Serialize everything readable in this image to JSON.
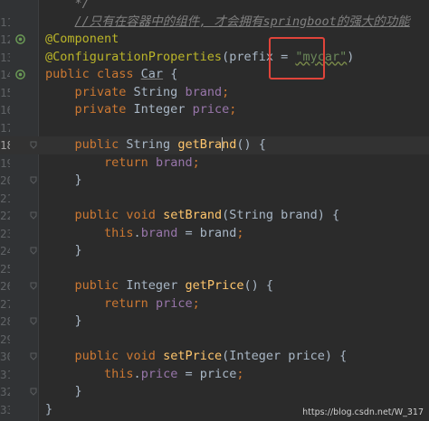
{
  "editor": {
    "lines": [
      {
        "num": "",
        "segments": [
          {
            "t": "    */",
            "c": "cmt"
          }
        ]
      },
      {
        "num": "11",
        "segments": [
          {
            "t": "    ",
            "c": ""
          },
          {
            "t": "//只有在容器中的组件, 才会拥有springboot的强大的功能",
            "c": "cmtline"
          }
        ]
      },
      {
        "num": "12",
        "gutter_icon": "spring-bean-icon",
        "segments": [
          {
            "t": "@Component",
            "c": "ann"
          }
        ]
      },
      {
        "num": "13",
        "segments": [
          {
            "t": "@ConfigurationProperties",
            "c": "ann"
          },
          {
            "t": "(",
            "c": ""
          },
          {
            "t": "prefix",
            "c": "pref"
          },
          {
            "t": " = ",
            "c": ""
          },
          {
            "t": "\"mycar\"",
            "c": "str wavy"
          },
          {
            "t": ")",
            "c": ""
          }
        ]
      },
      {
        "num": "14",
        "gutter_icon": "spring-bean-icon",
        "segments": [
          {
            "t": "public class ",
            "c": "kw"
          },
          {
            "t": "Car",
            "c": "cls"
          },
          {
            "t": " {",
            "c": ""
          }
        ]
      },
      {
        "num": "15",
        "segments": [
          {
            "t": "    ",
            "c": ""
          },
          {
            "t": "private ",
            "c": "kw"
          },
          {
            "t": "String ",
            "c": ""
          },
          {
            "t": "brand",
            "c": "fld"
          },
          {
            "t": ";",
            "c": "kw"
          }
        ]
      },
      {
        "num": "16",
        "segments": [
          {
            "t": "    ",
            "c": ""
          },
          {
            "t": "private ",
            "c": "kw"
          },
          {
            "t": "Integer ",
            "c": ""
          },
          {
            "t": "price",
            "c": "fld"
          },
          {
            "t": ";",
            "c": "kw"
          }
        ]
      },
      {
        "num": "17",
        "segments": []
      },
      {
        "num": "18",
        "current": true,
        "fold": true,
        "segments": [
          {
            "t": "    ",
            "c": ""
          },
          {
            "t": "public ",
            "c": "kw"
          },
          {
            "t": "String ",
            "c": ""
          },
          {
            "t": "getBra",
            "c": "fn"
          },
          {
            "t": "CARET",
            "c": "caret"
          },
          {
            "t": "nd",
            "c": "fn"
          },
          {
            "t": "() {",
            "c": ""
          }
        ]
      },
      {
        "num": "19",
        "segments": [
          {
            "t": "        ",
            "c": ""
          },
          {
            "t": "return ",
            "c": "kw"
          },
          {
            "t": "brand",
            "c": "fld"
          },
          {
            "t": ";",
            "c": "kw"
          }
        ]
      },
      {
        "num": "20",
        "fold": true,
        "segments": [
          {
            "t": "    }",
            "c": ""
          }
        ]
      },
      {
        "num": "21",
        "segments": []
      },
      {
        "num": "22",
        "fold": true,
        "segments": [
          {
            "t": "    ",
            "c": ""
          },
          {
            "t": "public void ",
            "c": "kw"
          },
          {
            "t": "setBrand",
            "c": "fn"
          },
          {
            "t": "(String brand) {",
            "c": ""
          }
        ]
      },
      {
        "num": "23",
        "segments": [
          {
            "t": "        ",
            "c": ""
          },
          {
            "t": "this",
            "c": "kw"
          },
          {
            "t": ".",
            "c": ""
          },
          {
            "t": "brand",
            "c": "fld"
          },
          {
            "t": " = brand",
            "c": ""
          },
          {
            "t": ";",
            "c": "kw"
          }
        ]
      },
      {
        "num": "24",
        "fold": true,
        "segments": [
          {
            "t": "    }",
            "c": ""
          }
        ]
      },
      {
        "num": "25",
        "segments": []
      },
      {
        "num": "26",
        "fold": true,
        "segments": [
          {
            "t": "    ",
            "c": ""
          },
          {
            "t": "public ",
            "c": "kw"
          },
          {
            "t": "Integer ",
            "c": ""
          },
          {
            "t": "getPrice",
            "c": "fn"
          },
          {
            "t": "() {",
            "c": ""
          }
        ]
      },
      {
        "num": "27",
        "segments": [
          {
            "t": "        ",
            "c": ""
          },
          {
            "t": "return ",
            "c": "kw"
          },
          {
            "t": "price",
            "c": "fld"
          },
          {
            "t": ";",
            "c": "kw"
          }
        ]
      },
      {
        "num": "28",
        "fold": true,
        "segments": [
          {
            "t": "    }",
            "c": ""
          }
        ]
      },
      {
        "num": "29",
        "segments": []
      },
      {
        "num": "30",
        "fold": true,
        "segments": [
          {
            "t": "    ",
            "c": ""
          },
          {
            "t": "public void ",
            "c": "kw"
          },
          {
            "t": "setPrice",
            "c": "fn"
          },
          {
            "t": "(Integer price) {",
            "c": ""
          }
        ]
      },
      {
        "num": "31",
        "segments": [
          {
            "t": "        ",
            "c": ""
          },
          {
            "t": "this",
            "c": "kw"
          },
          {
            "t": ".",
            "c": ""
          },
          {
            "t": "price",
            "c": "fld"
          },
          {
            "t": " = price",
            "c": ""
          },
          {
            "t": ";",
            "c": "kw"
          }
        ]
      },
      {
        "num": "32",
        "fold": true,
        "segments": [
          {
            "t": "    }",
            "c": ""
          }
        ]
      },
      {
        "num": "33",
        "segments": [
          {
            "t": "}",
            "c": ""
          }
        ]
      }
    ]
  },
  "watermark": "https://blog.csdn.net/W_317",
  "colors": {
    "background": "#2b2b2b",
    "gutter": "#313335",
    "keyword": "#cc7832",
    "annotation": "#bbb529",
    "string": "#6a8759",
    "method": "#ffc66d",
    "field": "#9876aa",
    "comment": "#808080",
    "highlight_box": "#e0443a"
  }
}
